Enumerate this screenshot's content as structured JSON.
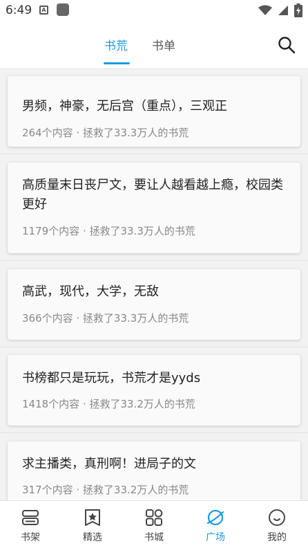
{
  "status_bar": {
    "time": "6:49",
    "icons": [
      "a-notification-icon",
      "app-notification-icon",
      "wifi-icon",
      "signal-icon",
      "battery-icon"
    ]
  },
  "header": {
    "tabs": [
      {
        "label": "书荒",
        "active": true
      },
      {
        "label": "书单",
        "active": false
      }
    ],
    "search_icon": "search-icon",
    "accent_color": "#1a9be6"
  },
  "requests": [
    {
      "title": "男频，神豪，无后宫（重点），三观正",
      "meta": "264个内容 · 拯救了33.3万人的书荒"
    },
    {
      "title": "高质量末日丧尸文，要让人越看越上瘾，校园类更好",
      "meta": "1179个内容 · 拯救了33.3万人的书荒"
    },
    {
      "title": "高武，现代，大学，无敌",
      "meta": "366个内容 · 拯救了33.3万人的书荒"
    },
    {
      "title": "书榜都只是玩玩，书荒才是yyds",
      "meta": "1418个内容 · 拯救了33.2万人的书荒"
    },
    {
      "title": "求主播类，真刑啊！进局子的文",
      "meta": "317个内容 · 拯救了33.2万人的书荒"
    }
  ],
  "bottom_nav": [
    {
      "label": "书架",
      "icon": "bookshelf-icon",
      "active": false
    },
    {
      "label": "精选",
      "icon": "star-badge-icon",
      "active": false
    },
    {
      "label": "书城",
      "icon": "grid-icon",
      "active": false
    },
    {
      "label": "广场",
      "icon": "planet-icon",
      "active": true
    },
    {
      "label": "我的",
      "icon": "smile-face-icon",
      "active": false
    }
  ]
}
